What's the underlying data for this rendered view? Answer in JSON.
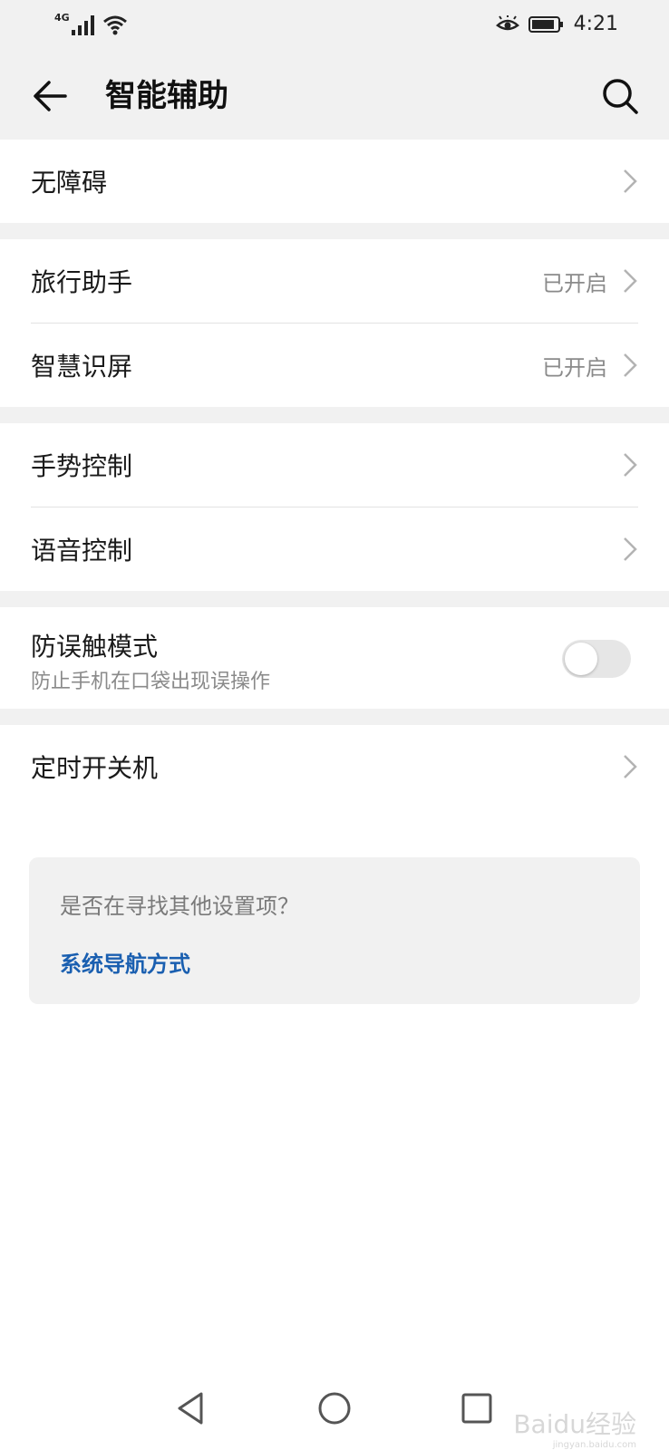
{
  "status_bar": {
    "network_type": "4G",
    "time": "4:21"
  },
  "app_bar": {
    "title": "智能辅助"
  },
  "groups": {
    "g1": {
      "accessibility": "无障碍"
    },
    "g2": {
      "travel_assistant": "旅行助手",
      "travel_assistant_status": "已开启",
      "smart_screen": "智慧识屏",
      "smart_screen_status": "已开启"
    },
    "g3": {
      "gesture_control": "手势控制",
      "voice_control": "语音控制"
    },
    "g4": {
      "anti_mistouch": "防误触模式",
      "anti_mistouch_desc": "防止手机在口袋出现误操作",
      "anti_mistouch_enabled": false
    },
    "g5": {
      "scheduled_power": "定时开关机"
    }
  },
  "card": {
    "question": "是否在寻找其他设置项？",
    "link": "系统导航方式"
  },
  "watermark": {
    "text": "Baidu经验",
    "sub": "jingyan.baidu.com"
  },
  "colors": {
    "page_bg": "#ffffff",
    "header_bg": "#f1f1f1",
    "link": "#1a5fb0",
    "secondary_text": "#8a8a8a"
  }
}
